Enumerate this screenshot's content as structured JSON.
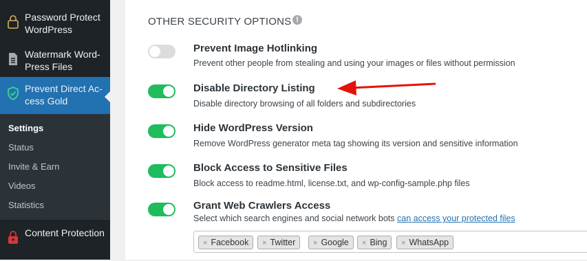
{
  "sidebar": {
    "items": [
      {
        "label": "Password Protect WordPress",
        "icon": "lock-icon"
      },
      {
        "label": "Watermark Word-Press Files",
        "icon": "document-icon"
      },
      {
        "label": "Prevent Direct Ac-cess Gold",
        "icon": "shield-icon"
      },
      {
        "label": "Content Protection",
        "icon": "lock-icon"
      }
    ],
    "submenu": [
      "Settings",
      "Status",
      "Invite & Earn",
      "Videos",
      "Statistics"
    ]
  },
  "section": {
    "title": "OTHER SECURITY OPTIONS",
    "info_icon": "!"
  },
  "options": [
    {
      "title": "Prevent Image Hotlinking",
      "description": "Prevent other people from stealing and using your images or files without permission",
      "enabled": false
    },
    {
      "title": "Disable Directory Listing",
      "description": "Disable directory browsing of all folders and subdirectories",
      "enabled": true
    },
    {
      "title": "Hide WordPress Version",
      "description": "Remove WordPress generator meta tag showing its version and sensitive information",
      "enabled": true
    },
    {
      "title": "Block Access to Sensitive Files",
      "description": "Block access to readme.html, license.txt, and wp-config-sample.php files",
      "enabled": true
    },
    {
      "title": "Grant Web Crawlers Access",
      "description": "Select which search engines and social network bots ",
      "link": "can access your protected files",
      "enabled": true
    }
  ],
  "crawler_tags": [
    {
      "remove": "×",
      "label": "Facebook"
    },
    {
      "remove": "×",
      "label": "Twitter"
    },
    {
      "remove": "×",
      "label": "Google"
    },
    {
      "remove": "×",
      "label": "Bing"
    },
    {
      "remove": "×",
      "label": "WhatsApp"
    }
  ],
  "colors": {
    "sidebar_bg": "#1d2327",
    "active_menu": "#2271b1",
    "toggle_on": "#1ebc5d",
    "toggle_off": "#dcdcde",
    "annotation_arrow": "#e3120b"
  }
}
